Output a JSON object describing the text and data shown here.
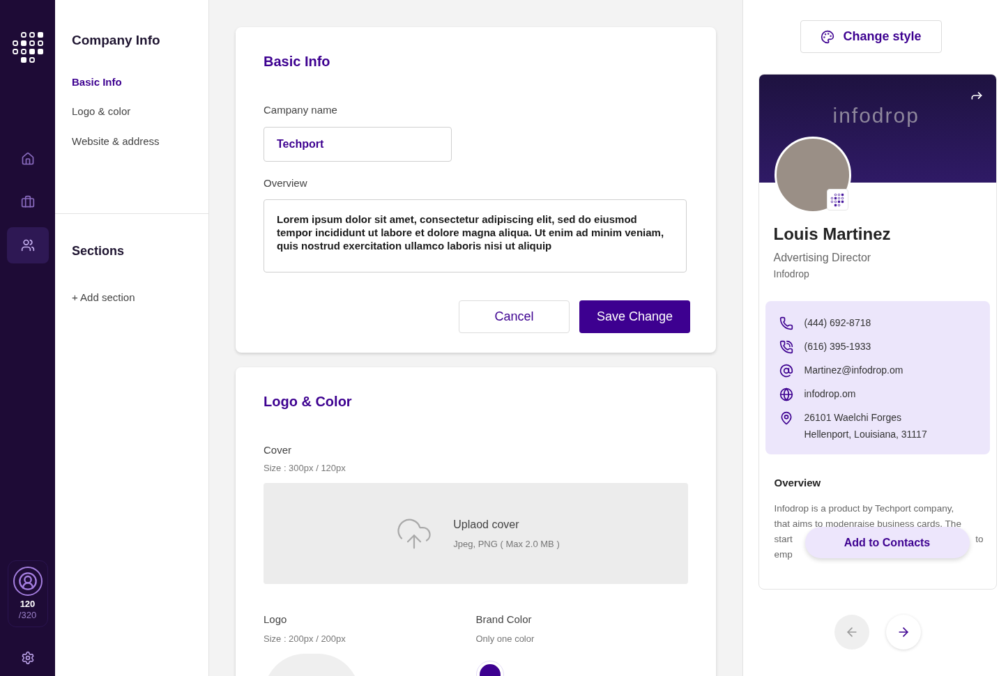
{
  "rail": {
    "items": [
      {
        "kind": "home",
        "selected": false
      },
      {
        "kind": "briefcase",
        "selected": false
      },
      {
        "kind": "users",
        "selected": true
      }
    ],
    "credits": {
      "used": "120",
      "total": "/320"
    }
  },
  "subnav": {
    "title": "Company Info",
    "items": [
      {
        "label": "Basic Info",
        "selected": true
      },
      {
        "label": "Logo & color",
        "selected": false
      },
      {
        "label": "Website & address",
        "selected": false
      }
    ],
    "sections_title": "Sections",
    "add_section": "+ Add section"
  },
  "basic_info": {
    "title": "Basic Info",
    "company_label": "Campany name",
    "company_value": "Techport",
    "overview_label": "Overview",
    "overview_value": "Lorem ipsum dolor sit amet, consectetur adipiscing elit, sed do eiusmod tempor incididunt ut labore et dolore magna aliqua. Ut enim ad minim veniam, quis nostrud exercitation ullamco laboris nisi ut aliquip",
    "cancel": "Cancel",
    "save": "Save Change"
  },
  "logo_color": {
    "title": "Logo & Color",
    "cover_label": "Cover",
    "cover_size": "Size : 300px / 120px",
    "upload_title": "Uplaod cover",
    "upload_hint": "Jpeg, PNG ( Max 2.0 MB )",
    "logo_label": "Logo",
    "logo_size": "Size : 200px / 200px",
    "brand_label": "Brand Color",
    "brand_hint": "Only one color",
    "brand_colors": [
      {
        "color": "#3d0090"
      }
    ]
  },
  "preview": {
    "change_style": "Change style",
    "cover_brand": "infodrop",
    "name": "Louis Martinez",
    "role": "Advertising Director",
    "company": "Infodrop",
    "contacts": [
      {
        "kind": "phone",
        "lines": [
          "(444) 692-8718"
        ]
      },
      {
        "kind": "landline",
        "lines": [
          "(616) 395-1933"
        ]
      },
      {
        "kind": "email",
        "lines": [
          "Martinez@infodrop.om"
        ]
      },
      {
        "kind": "web",
        "lines": [
          "infodrop.om"
        ]
      },
      {
        "kind": "address",
        "lines": [
          "26101 Waelchi Forges",
          "Hellenport, Louisiana, 31117"
        ]
      }
    ],
    "overview_title": "Overview",
    "overview_lines": [
      "Infodrop is a product by Techport company,",
      "that aims to modenraise business cards. The"
    ],
    "overview_cut": [
      "start",
      "to",
      "emp"
    ],
    "add_contacts": "Add to Contacts"
  }
}
